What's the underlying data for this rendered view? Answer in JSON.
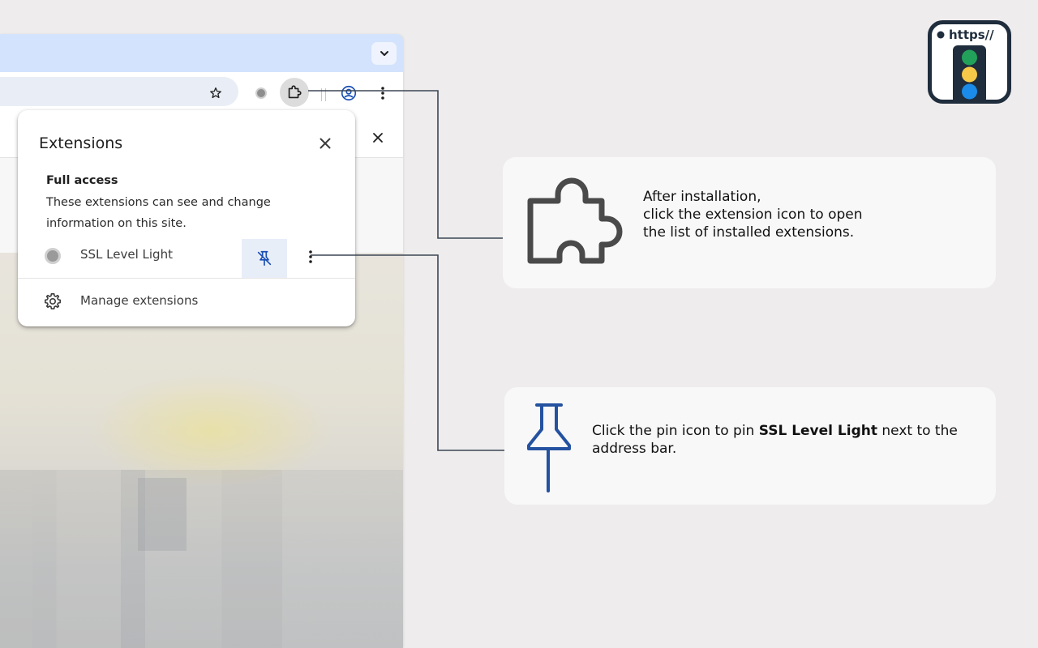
{
  "browser": {
    "tab_search_icon": "chevron-down-icon",
    "toolbar_icons": [
      "star-icon",
      "extension-icon",
      "puzzle-icon",
      "profile-icon",
      "kebab-menu-icon"
    ]
  },
  "extensions_popup": {
    "title": "Extensions",
    "section_title": "Full access",
    "section_desc": "These extensions can see and change information on this site.",
    "extension_name": "SSL Level Light",
    "manage_label": "Manage extensions"
  },
  "callouts": {
    "first_lines": [
      "After installation,",
      "click the extension icon to open",
      "the list of installed extensions."
    ],
    "second_prefix": "Click the pin icon to pin ",
    "second_bold": "SSL Level Light",
    "second_suffix": " next to the address bar."
  },
  "logo": {
    "text": "https//",
    "lights": [
      "#22a15a",
      "#f7c948",
      "#1a8be8"
    ]
  },
  "colors": {
    "accent_blue": "#2452a0",
    "tabstrip": "#d3e3fd",
    "connector": "#3c4654"
  }
}
